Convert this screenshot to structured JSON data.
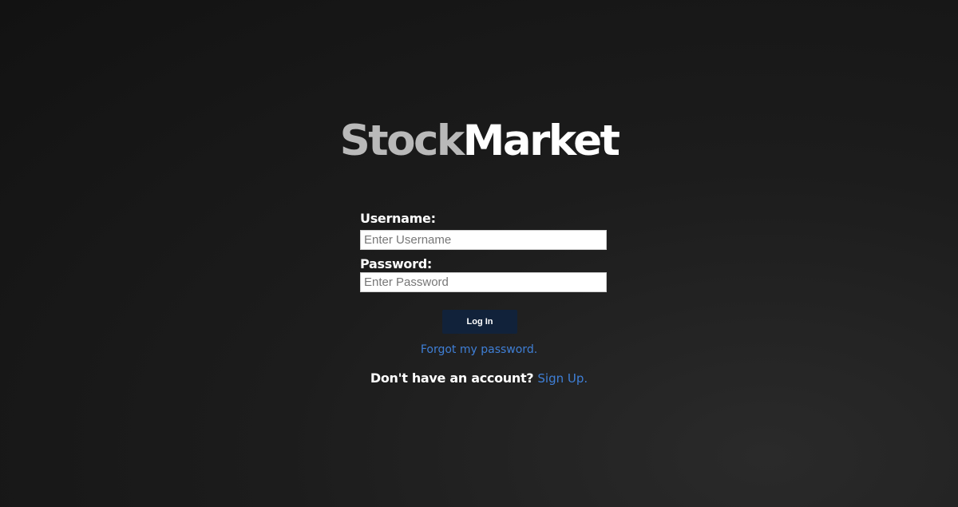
{
  "logo": {
    "part1": "Stock",
    "part2": "Market"
  },
  "form": {
    "username_label": "Username:",
    "username_placeholder": "Enter Username",
    "username_value": "",
    "password_label": "Password:",
    "password_placeholder": "Enter Password",
    "password_value": "",
    "login_label": "Log In"
  },
  "links": {
    "forgot": "Forgot my password.",
    "signup_prompt": "Don't have an account?",
    "signup": "Sign Up."
  },
  "colors": {
    "background": "#1c1c1c",
    "button": "#11223a",
    "link": "#3f7fd6",
    "logo_light": "#b9b9b9",
    "logo_bold": "#ffffff"
  }
}
